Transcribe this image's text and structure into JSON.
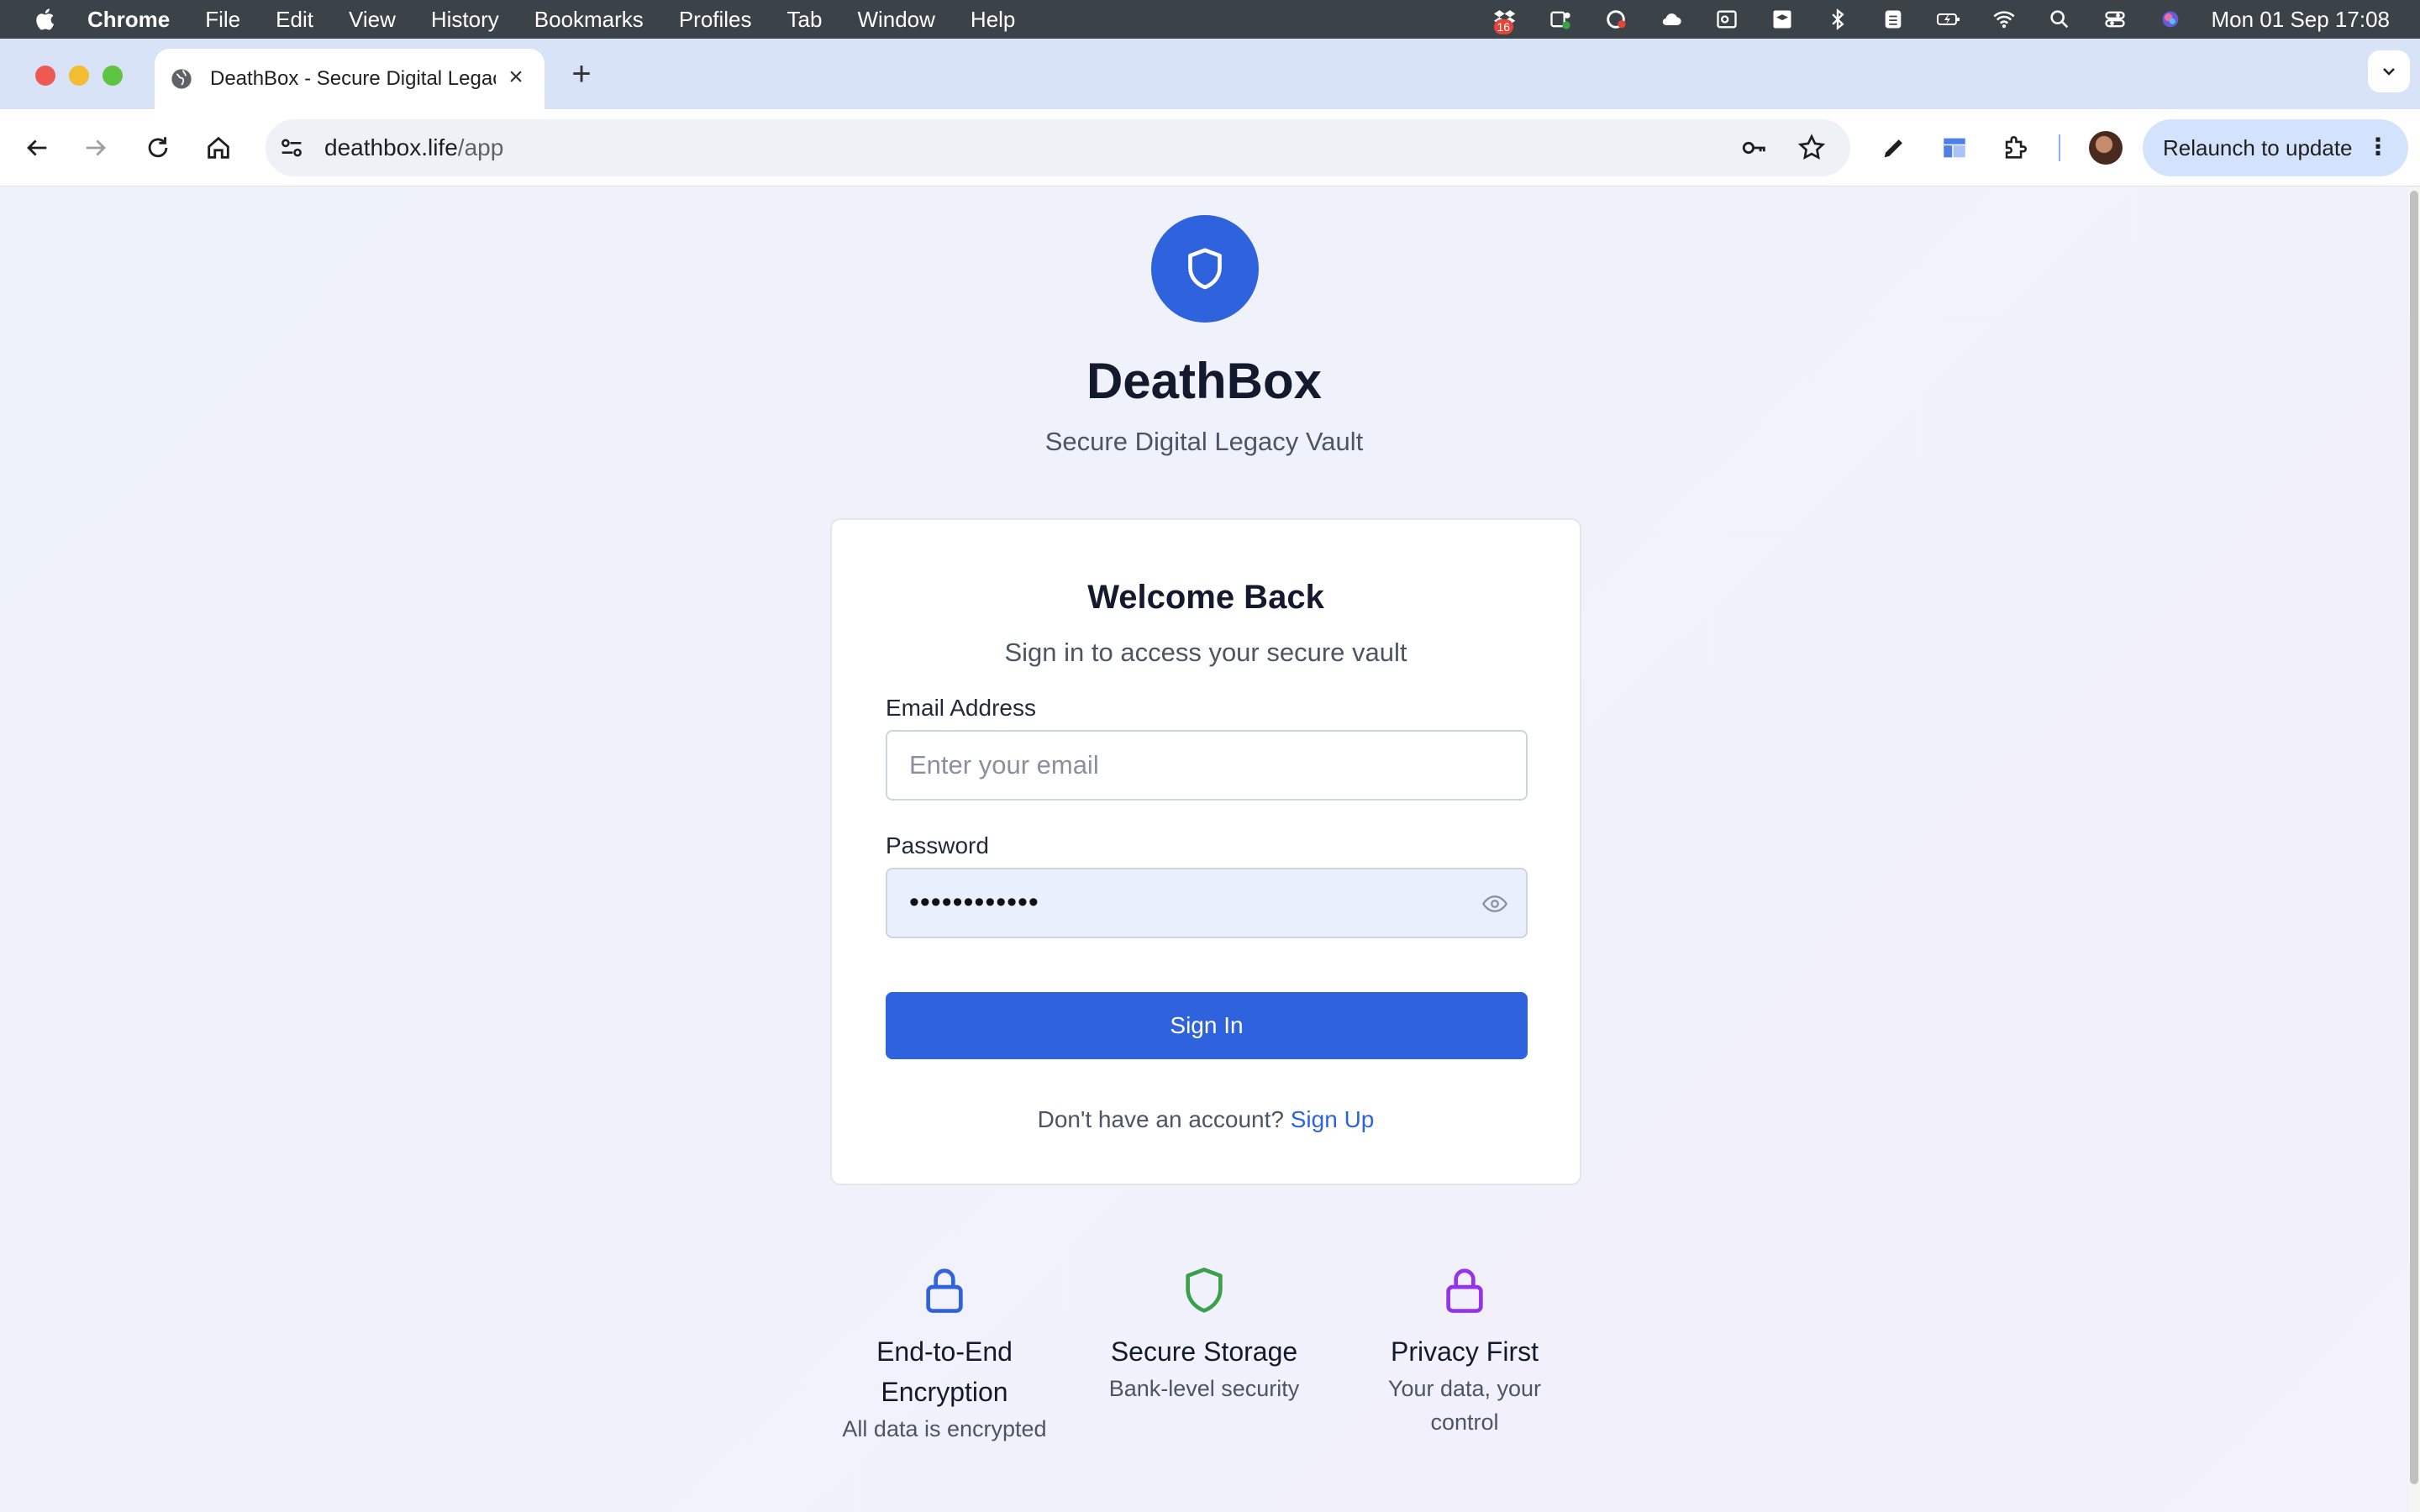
{
  "menubar": {
    "app": "Chrome",
    "items": [
      "File",
      "Edit",
      "View",
      "History",
      "Bookmarks",
      "Profiles",
      "Tab",
      "Window",
      "Help"
    ],
    "badge_count": "16",
    "clock": "Mon 01 Sep  17:08"
  },
  "browser": {
    "tab_title": "DeathBox - Secure Digital Legacy Vault",
    "url_domain": "deathbox.life",
    "url_path": "/app",
    "relaunch_label": "Relaunch to update"
  },
  "page": {
    "brand": "DeathBox",
    "tagline": "Secure Digital Legacy Vault",
    "card": {
      "title": "Welcome Back",
      "subtitle": "Sign in to access your secure vault",
      "email_label": "Email Address",
      "email_placeholder": "Enter your email",
      "password_label": "Password",
      "password_value": "••••••••••••",
      "signin_label": "Sign In",
      "signup_prompt": "Don't have an account?",
      "signup_link": "Sign Up"
    },
    "features": [
      {
        "title": "End-to-End Encryption",
        "desc": "All data is encrypted",
        "icon": "lock-icon",
        "color": "#2f63de"
      },
      {
        "title": "Secure Storage",
        "desc": "Bank-level security",
        "icon": "shield-icon",
        "color": "#3aa04a"
      },
      {
        "title": "Privacy First",
        "desc": "Your data, your control",
        "icon": "lock-icon",
        "color": "#9333ea"
      }
    ]
  },
  "colors": {
    "accent": "#2f63de",
    "menubar": "#3c4348",
    "tabstrip": "#d9e3f7"
  }
}
